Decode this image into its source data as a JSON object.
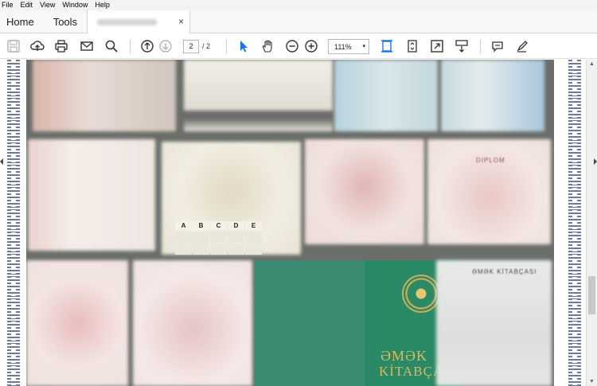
{
  "menu": {
    "items": [
      "File",
      "Edit",
      "View",
      "Window",
      "Help"
    ]
  },
  "nav": {
    "home_label": "Home",
    "tools_label": "Tools"
  },
  "document_tab": {
    "close_glyph": "×"
  },
  "toolbar": {
    "icons": [
      "save-icon",
      "upload-cloud-icon",
      "print-icon",
      "email-icon",
      "search-icon",
      "previous-page-icon",
      "next-page-icon",
      "select-cursor-icon",
      "hand-icon",
      "zoom-out-icon",
      "zoom-in-icon",
      "fit-page-icon",
      "rotate-page-icon",
      "full-screen-icon",
      "scroll-mode-icon",
      "comment-icon",
      "highlight-pen-icon"
    ],
    "current_page": "2",
    "page_total": "/ 2",
    "zoom_value": "111%",
    "zoom_caret": "▾"
  },
  "document": {
    "license_categories": [
      "A",
      "B",
      "C",
      "D",
      "E"
    ],
    "diplom_label": "DIPLOM",
    "book_line1": "ƏMƏK",
    "book_line2": "KİTABÇASI",
    "book_label_small": "ƏMƏK KİTABÇASI"
  },
  "colors": {
    "accent": "#1a73e8",
    "book_green": "#2a8a66",
    "gold_text": "#d8b95e"
  }
}
